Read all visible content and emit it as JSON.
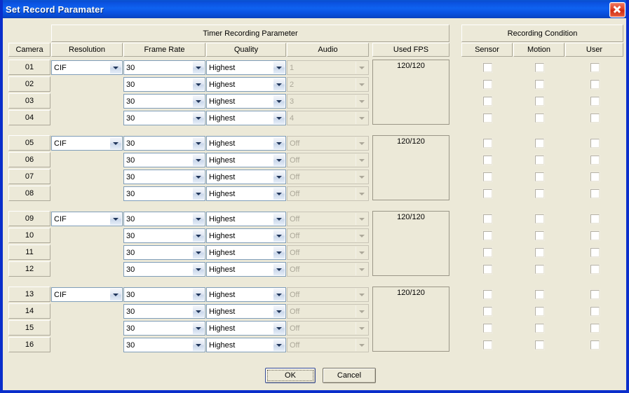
{
  "window": {
    "title": "Set Record Paramater",
    "close_icon": "close-icon"
  },
  "headers": {
    "group_timer": "Timer Recording Parameter",
    "group_condition": "Recording Condition",
    "camera": "Camera",
    "resolution": "Resolution",
    "frame_rate": "Frame Rate",
    "quality": "Quality",
    "audio": "Audio",
    "used_fps": "Used FPS",
    "sensor": "Sensor",
    "motion": "Motion",
    "user": "User"
  },
  "groups": [
    {
      "used_fps": "120/120",
      "resolution": "CIF",
      "rows": [
        {
          "camera": "01",
          "frame_rate": "30",
          "quality": "Highest",
          "audio": "1",
          "sensor": false,
          "motion": false,
          "user": false
        },
        {
          "camera": "02",
          "frame_rate": "30",
          "quality": "Highest",
          "audio": "2",
          "sensor": false,
          "motion": false,
          "user": false
        },
        {
          "camera": "03",
          "frame_rate": "30",
          "quality": "Highest",
          "audio": "3",
          "sensor": false,
          "motion": false,
          "user": false
        },
        {
          "camera": "04",
          "frame_rate": "30",
          "quality": "Highest",
          "audio": "4",
          "sensor": false,
          "motion": false,
          "user": false
        }
      ]
    },
    {
      "used_fps": "120/120",
      "resolution": "CIF",
      "rows": [
        {
          "camera": "05",
          "frame_rate": "30",
          "quality": "Highest",
          "audio": "Off",
          "sensor": false,
          "motion": false,
          "user": false
        },
        {
          "camera": "06",
          "frame_rate": "30",
          "quality": "Highest",
          "audio": "Off",
          "sensor": false,
          "motion": false,
          "user": false
        },
        {
          "camera": "07",
          "frame_rate": "30",
          "quality": "Highest",
          "audio": "Off",
          "sensor": false,
          "motion": false,
          "user": false
        },
        {
          "camera": "08",
          "frame_rate": "30",
          "quality": "Highest",
          "audio": "Off",
          "sensor": false,
          "motion": false,
          "user": false
        }
      ]
    },
    {
      "used_fps": "120/120",
      "resolution": "CIF",
      "rows": [
        {
          "camera": "09",
          "frame_rate": "30",
          "quality": "Highest",
          "audio": "Off",
          "sensor": false,
          "motion": false,
          "user": false
        },
        {
          "camera": "10",
          "frame_rate": "30",
          "quality": "Highest",
          "audio": "Off",
          "sensor": false,
          "motion": false,
          "user": false
        },
        {
          "camera": "11",
          "frame_rate": "30",
          "quality": "Highest",
          "audio": "Off",
          "sensor": false,
          "motion": false,
          "user": false
        },
        {
          "camera": "12",
          "frame_rate": "30",
          "quality": "Highest",
          "audio": "Off",
          "sensor": false,
          "motion": false,
          "user": false
        }
      ]
    },
    {
      "used_fps": "120/120",
      "resolution": "CIF",
      "rows": [
        {
          "camera": "13",
          "frame_rate": "30",
          "quality": "Highest",
          "audio": "Off",
          "sensor": false,
          "motion": false,
          "user": false
        },
        {
          "camera": "14",
          "frame_rate": "30",
          "quality": "Highest",
          "audio": "Off",
          "sensor": false,
          "motion": false,
          "user": false
        },
        {
          "camera": "15",
          "frame_rate": "30",
          "quality": "Highest",
          "audio": "Off",
          "sensor": false,
          "motion": false,
          "user": false
        },
        {
          "camera": "16",
          "frame_rate": "30",
          "quality": "Highest",
          "audio": "Off",
          "sensor": false,
          "motion": false,
          "user": false
        }
      ]
    }
  ],
  "buttons": {
    "ok": "OK",
    "cancel": "Cancel"
  },
  "colors": {
    "titlebar_blue": "#0f62f0",
    "dialog_border_blue": "#0a2ecb",
    "face": "#ece9d8",
    "close_red": "#cf2b12",
    "combo_border": "#7f9db9"
  }
}
